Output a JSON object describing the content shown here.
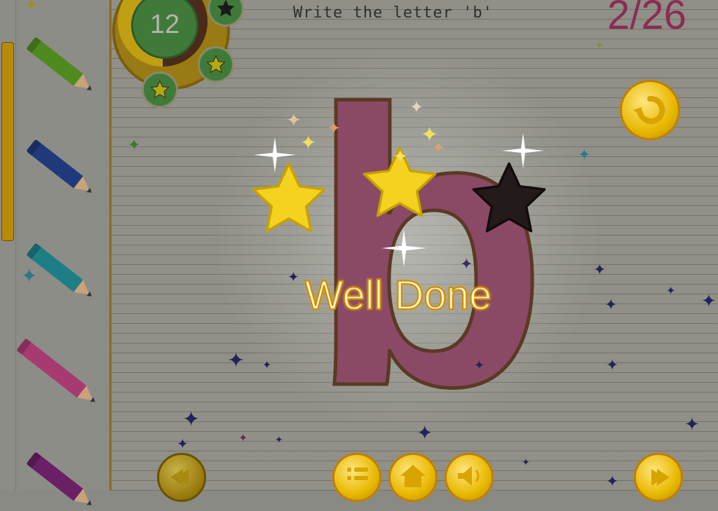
{
  "header": {
    "prompt": "Write the letter 'b'",
    "progress": "2/26"
  },
  "timer": {
    "value": "12",
    "badges": [
      "star-badge",
      "star-badge",
      "dark-star-badge"
    ]
  },
  "tracing": {
    "letter": "b"
  },
  "result": {
    "message": "Well Done",
    "stars_earned": 2,
    "stars_total": 3
  },
  "pencils": [
    {
      "name": "green",
      "color": "#4e8a1e"
    },
    {
      "name": "blue",
      "color": "#1f3a7a"
    },
    {
      "name": "teal",
      "color": "#1e7e86"
    },
    {
      "name": "pink",
      "color": "#a83a72"
    },
    {
      "name": "purple",
      "color": "#6a1f66"
    }
  ],
  "controls": {
    "replay": "replay-icon",
    "back": "back-arrow-icon",
    "menu": "list-icon",
    "home": "home-icon",
    "sound": "speaker-icon",
    "next": "forward-arrow-icon"
  },
  "colors": {
    "accent": "#e8b800",
    "counter": "#8a2d52",
    "letter": "#8a4a66"
  }
}
